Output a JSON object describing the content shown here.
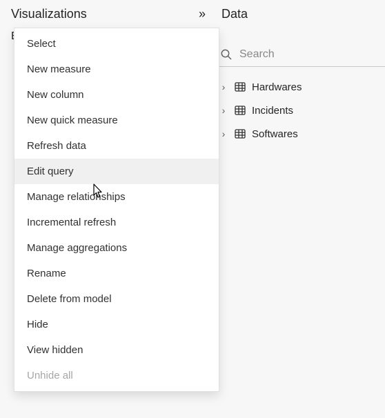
{
  "viz_panel": {
    "title": "Visualizations",
    "body_hint_char": "E"
  },
  "data_panel": {
    "title": "Data",
    "search_placeholder": "Search",
    "tables": [
      {
        "name": "Hardwares"
      },
      {
        "name": "Incidents"
      },
      {
        "name": "Softwares"
      }
    ]
  },
  "context_menu": {
    "items": [
      {
        "label": "Select",
        "disabled": false,
        "hovered": false
      },
      {
        "label": "New measure",
        "disabled": false,
        "hovered": false
      },
      {
        "label": "New column",
        "disabled": false,
        "hovered": false
      },
      {
        "label": "New quick measure",
        "disabled": false,
        "hovered": false
      },
      {
        "label": "Refresh data",
        "disabled": false,
        "hovered": false
      },
      {
        "label": "Edit query",
        "disabled": false,
        "hovered": true
      },
      {
        "label": "Manage relationships",
        "disabled": false,
        "hovered": false
      },
      {
        "label": "Incremental refresh",
        "disabled": false,
        "hovered": false
      },
      {
        "label": "Manage aggregations",
        "disabled": false,
        "hovered": false
      },
      {
        "label": "Rename",
        "disabled": false,
        "hovered": false
      },
      {
        "label": "Delete from model",
        "disabled": false,
        "hovered": false
      },
      {
        "label": "Hide",
        "disabled": false,
        "hovered": false
      },
      {
        "label": "View hidden",
        "disabled": false,
        "hovered": false
      },
      {
        "label": "Unhide all",
        "disabled": true,
        "hovered": false
      }
    ]
  }
}
